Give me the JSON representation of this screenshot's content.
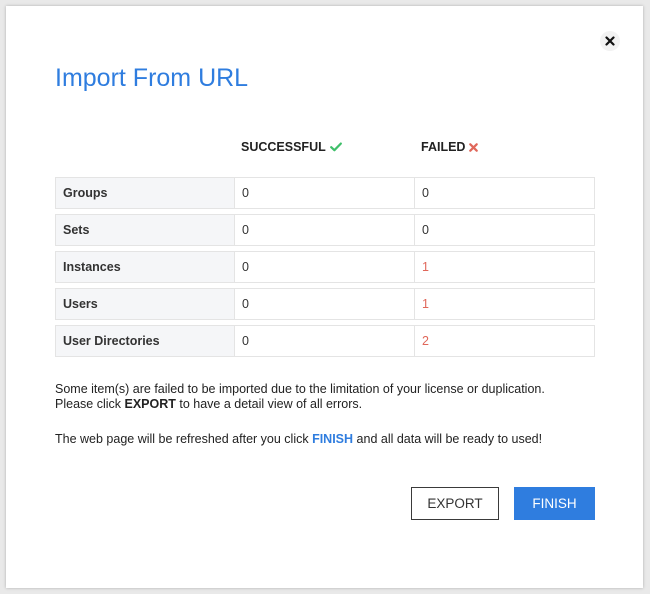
{
  "dialog": {
    "title": "Import From URL"
  },
  "columns": {
    "successful": "SUCCESSFUL",
    "failed": "FAILED"
  },
  "rows": [
    {
      "label": "Groups",
      "successful": "0",
      "failed": "0"
    },
    {
      "label": "Sets",
      "successful": "0",
      "failed": "0"
    },
    {
      "label": "Instances",
      "successful": "0",
      "failed": "1"
    },
    {
      "label": "Users",
      "successful": "0",
      "failed": "1"
    },
    {
      "label": "User Directories",
      "successful": "0",
      "failed": "2"
    }
  ],
  "message1": {
    "line1": "Some item(s) are failed to be imported due to the limitation of your license or duplication.",
    "line2_prefix": "Please click ",
    "line2_strong": "EXPORT",
    "line2_suffix": " to have a detail view of all errors."
  },
  "message2": {
    "prefix": "The web page will be refreshed after you click ",
    "strong": "FINISH",
    "suffix": " and all data will be ready to used!"
  },
  "buttons": {
    "export": "EXPORT",
    "finish": "FINISH"
  },
  "colors": {
    "accent": "#2f7ddf",
    "success": "#3fbf6a",
    "failed": "#e0675a"
  },
  "icons": {
    "close": "close-icon",
    "success": "check-icon",
    "failed": "x-icon"
  }
}
